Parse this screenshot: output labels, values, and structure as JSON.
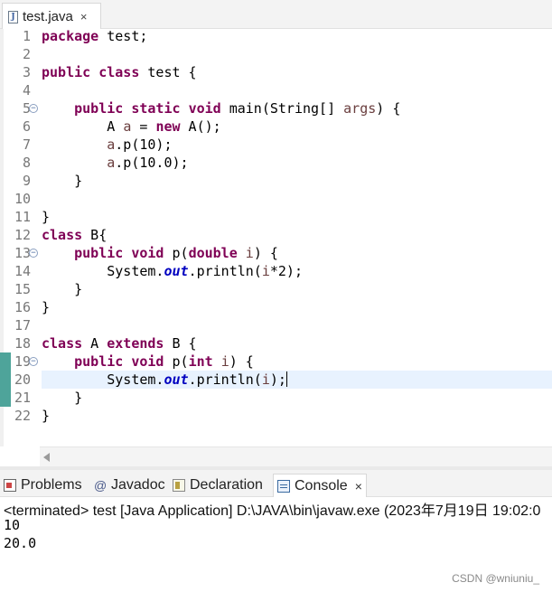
{
  "editor_tab": {
    "file_name": "test.java",
    "close_glyph": "×",
    "icon": "java-file-icon"
  },
  "code_lines": [
    {
      "n": "1",
      "tokens": [
        {
          "t": "package",
          "c": "kw"
        },
        {
          "t": " test;"
        }
      ]
    },
    {
      "n": "2",
      "tokens": []
    },
    {
      "n": "3",
      "tokens": [
        {
          "t": "public",
          "c": "kw"
        },
        {
          "t": " "
        },
        {
          "t": "class",
          "c": "kw"
        },
        {
          "t": " test {"
        }
      ]
    },
    {
      "n": "4",
      "tokens": []
    },
    {
      "n": "5",
      "fold": true,
      "tokens": [
        {
          "t": "    "
        },
        {
          "t": "public",
          "c": "kw"
        },
        {
          "t": " "
        },
        {
          "t": "static",
          "c": "kw"
        },
        {
          "t": " "
        },
        {
          "t": "void",
          "c": "kw"
        },
        {
          "t": " main(String[] "
        },
        {
          "t": "args",
          "c": "var"
        },
        {
          "t": ") {"
        }
      ]
    },
    {
      "n": "6",
      "tokens": [
        {
          "t": "        A "
        },
        {
          "t": "a",
          "c": "var"
        },
        {
          "t": " = "
        },
        {
          "t": "new",
          "c": "kw"
        },
        {
          "t": " A();"
        }
      ]
    },
    {
      "n": "7",
      "tokens": [
        {
          "t": "        "
        },
        {
          "t": "a",
          "c": "var"
        },
        {
          "t": ".p(10);"
        }
      ]
    },
    {
      "n": "8",
      "tokens": [
        {
          "t": "        "
        },
        {
          "t": "a",
          "c": "var"
        },
        {
          "t": ".p(10.0);"
        }
      ]
    },
    {
      "n": "9",
      "tokens": [
        {
          "t": "    }"
        }
      ]
    },
    {
      "n": "10",
      "tokens": []
    },
    {
      "n": "11",
      "tokens": [
        {
          "t": "}"
        }
      ]
    },
    {
      "n": "12",
      "tokens": [
        {
          "t": "class",
          "c": "kw"
        },
        {
          "t": " B{"
        }
      ]
    },
    {
      "n": "13",
      "fold": true,
      "tokens": [
        {
          "t": "    "
        },
        {
          "t": "public",
          "c": "kw"
        },
        {
          "t": " "
        },
        {
          "t": "void",
          "c": "kw"
        },
        {
          "t": " p("
        },
        {
          "t": "double",
          "c": "kw"
        },
        {
          "t": " "
        },
        {
          "t": "i",
          "c": "var"
        },
        {
          "t": ") {"
        }
      ]
    },
    {
      "n": "14",
      "tokens": [
        {
          "t": "        System."
        },
        {
          "t": "out",
          "c": "fld"
        },
        {
          "t": ".println("
        },
        {
          "t": "i",
          "c": "var"
        },
        {
          "t": "*2);"
        }
      ]
    },
    {
      "n": "15",
      "tokens": [
        {
          "t": "    }"
        }
      ]
    },
    {
      "n": "16",
      "tokens": [
        {
          "t": "}"
        }
      ]
    },
    {
      "n": "17",
      "tokens": []
    },
    {
      "n": "18",
      "tokens": [
        {
          "t": "class",
          "c": "kw"
        },
        {
          "t": " A "
        },
        {
          "t": "extends",
          "c": "kw"
        },
        {
          "t": " B {"
        }
      ]
    },
    {
      "n": "19",
      "fold": true,
      "changed": true,
      "tokens": [
        {
          "t": "    "
        },
        {
          "t": "public",
          "c": "kw"
        },
        {
          "t": " "
        },
        {
          "t": "void",
          "c": "kw"
        },
        {
          "t": " p("
        },
        {
          "t": "int",
          "c": "kw"
        },
        {
          "t": " "
        },
        {
          "t": "i",
          "c": "var"
        },
        {
          "t": ") {"
        }
      ]
    },
    {
      "n": "20",
      "current": true,
      "changed": true,
      "tokens": [
        {
          "t": "        System."
        },
        {
          "t": "out",
          "c": "fld"
        },
        {
          "t": ".println("
        },
        {
          "t": "i",
          "c": "var"
        },
        {
          "t": ");"
        },
        {
          "caret": true
        }
      ]
    },
    {
      "n": "21",
      "changed": true,
      "tokens": [
        {
          "t": "    }"
        }
      ]
    },
    {
      "n": "22",
      "tokens": [
        {
          "t": "}"
        }
      ]
    }
  ],
  "view_tabs": [
    {
      "label": "Problems",
      "icon": "problems-icon"
    },
    {
      "label": "Javadoc",
      "icon": "javadoc-icon",
      "glyph": "@"
    },
    {
      "label": "Declaration",
      "icon": "declaration-icon"
    },
    {
      "label": "Console",
      "icon": "console-icon",
      "active": true,
      "close_glyph": "×"
    }
  ],
  "console": {
    "status": "<terminated> test [Java Application] D:\\JAVA\\bin\\javaw.exe  (2023年7月19日 19:02:0",
    "output": [
      "10",
      "20.0"
    ],
    "watermark": "CSDN @wniuniu_"
  }
}
